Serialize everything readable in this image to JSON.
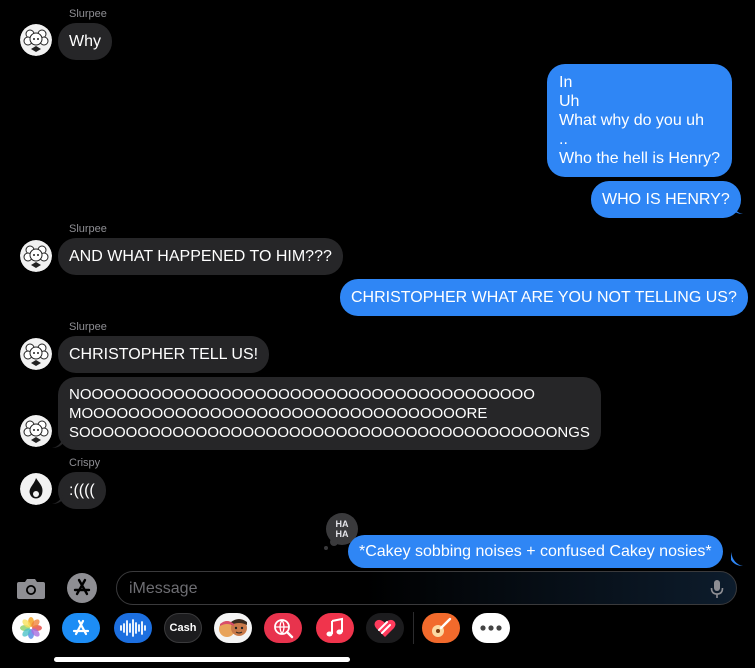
{
  "messages": [
    {
      "sender": "Slurpee",
      "text": "Why"
    },
    {
      "text": "In\nUh\nWhat why do you uh\n..\nWho the hell is Henry?"
    },
    {
      "text": "WHO IS HENRY?"
    },
    {
      "sender": "Slurpee",
      "text": "AND WHAT HAPPENED TO HIM???"
    },
    {
      "text": "CHRISTOPHER WHAT ARE YOU NOT TELLING US?"
    },
    {
      "sender": "Slurpee",
      "text": "CHRISTOPHER TELL US!"
    },
    {
      "text": "NOOOOOOOOOOOOOOOOOOOOOOOOOOOOOOOOOOOOOOO\nMOOOOOOOOOOOOOOOOOOOOOOOOOOOOOOOOORE\nSOOOOOOOOOOOOOOOOOOOOOOOOOOOOOOOOOOOOOOOOONGS"
    },
    {
      "sender": "Crispy",
      "text": ":(((("
    },
    {
      "text": "*Cakey sobbing noises + confused Cakey nosies*",
      "tapback": "HA HA"
    }
  ],
  "compose": {
    "placeholder": "iMessage",
    "left_icons": [
      "camera-icon",
      "app-store-icon"
    ],
    "right_icon": "microphone-icon"
  },
  "app_strip": [
    {
      "name": "photos"
    },
    {
      "name": "app-store"
    },
    {
      "name": "audio"
    },
    {
      "name": "apple-cash",
      "label": "Cash"
    },
    {
      "name": "memoji"
    },
    {
      "name": "images-search"
    },
    {
      "name": "music"
    },
    {
      "name": "digital-touch"
    },
    {
      "name": "garageband"
    },
    {
      "name": "more"
    }
  ],
  "colors": {
    "background": "#000000",
    "incoming_bubble": "#262628",
    "outgoing_bubble": "#2f86f5",
    "sender_name": "#8e8e93",
    "placeholder": "#6e6e73"
  }
}
